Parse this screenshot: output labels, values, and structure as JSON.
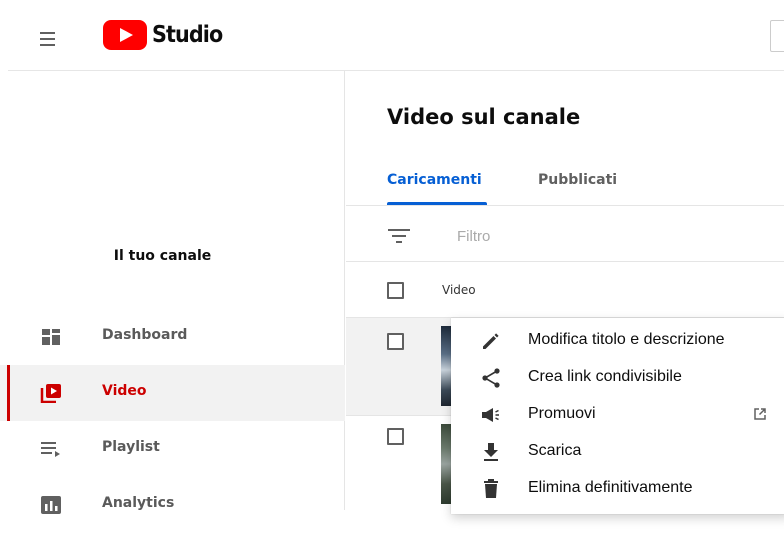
{
  "header": {
    "logo_text": "Studio"
  },
  "sidebar": {
    "channel_label": "Il tuo canale",
    "items": [
      {
        "label": "Dashboard",
        "icon": "dashboard-icon",
        "active": false
      },
      {
        "label": "Video",
        "icon": "video-icon",
        "active": true
      },
      {
        "label": "Playlist",
        "icon": "playlist-icon",
        "active": false
      },
      {
        "label": "Analytics",
        "icon": "analytics-icon",
        "active": false
      }
    ]
  },
  "main": {
    "title": "Video sul canale",
    "tabs": [
      {
        "label": "Caricamenti",
        "active": true
      },
      {
        "label": "Pubblicati",
        "active": false
      }
    ],
    "filter_placeholder": "Filtro",
    "table": {
      "column_video": "Video"
    }
  },
  "menu": {
    "items": [
      {
        "label": "Modifica titolo e descrizione",
        "icon": "pencil-icon"
      },
      {
        "label": "Crea link condivisibile",
        "icon": "share-icon"
      },
      {
        "label": "Promuovi",
        "icon": "megaphone-icon",
        "external": true
      },
      {
        "label": "Scarica",
        "icon": "download-icon"
      },
      {
        "label": "Elimina definitivamente",
        "icon": "trash-icon"
      }
    ]
  },
  "colors": {
    "brand_red": "#ff0000",
    "active_red": "#cc0000",
    "tab_blue": "#065fd4"
  }
}
